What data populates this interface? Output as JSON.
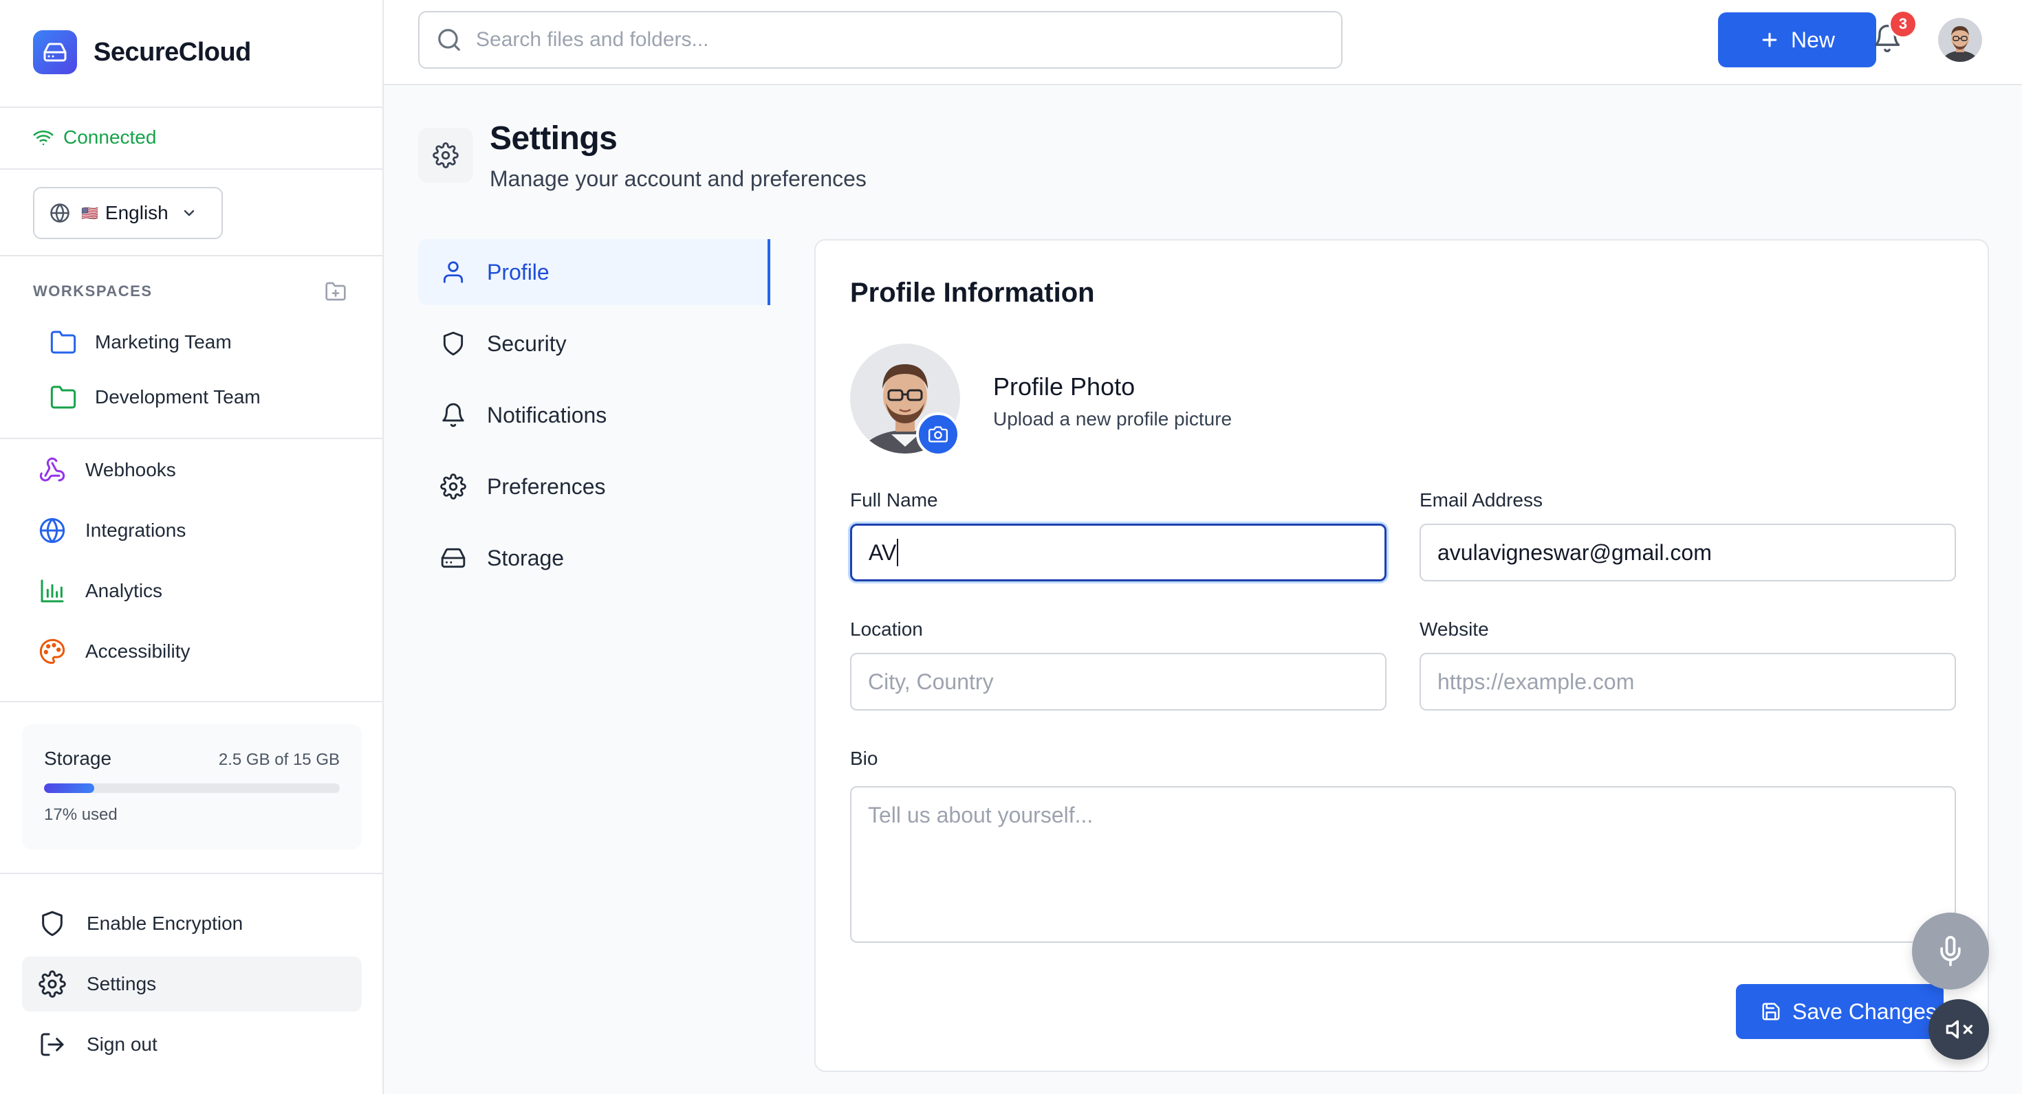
{
  "app": {
    "name": "SecureCloud",
    "accent": "#2563eb"
  },
  "sidebar": {
    "connection": {
      "status": "Connected",
      "color": "#16a34a",
      "icon": "wifi-icon"
    },
    "language": {
      "flag": "🇺🇸",
      "label": "English"
    },
    "workspaces": {
      "title": "WORKSPACES",
      "items": [
        {
          "label": "Marketing Team",
          "icon": "folder-icon",
          "color": "#2563eb"
        },
        {
          "label": "Development Team",
          "icon": "folder-icon",
          "color": "#16a34a"
        }
      ]
    },
    "nav": [
      {
        "label": "Webhooks",
        "icon": "webhook-icon",
        "color": "#9333ea"
      },
      {
        "label": "Integrations",
        "icon": "globe-icon",
        "color": "#2563eb"
      },
      {
        "label": "Analytics",
        "icon": "bar-chart-icon",
        "color": "#16a34a"
      },
      {
        "label": "Accessibility",
        "icon": "palette-icon",
        "color": "#ea580c"
      }
    ],
    "storage": {
      "title": "Storage",
      "size": "2.5 GB of 15 GB",
      "used_label": "17% used",
      "used_fraction": 0.17
    },
    "bottom": [
      {
        "label": "Enable Encryption",
        "icon": "shield-icon"
      },
      {
        "label": "Settings",
        "icon": "gear-icon",
        "active": true
      },
      {
        "label": "Sign out",
        "icon": "logout-icon"
      }
    ]
  },
  "header": {
    "search_placeholder": "Search files and folders...",
    "new_label": "New",
    "notifications_count": "3"
  },
  "page": {
    "title": "Settings",
    "subtitle": "Manage your account and preferences",
    "tabs": [
      {
        "label": "Profile",
        "icon": "user-icon",
        "active": true
      },
      {
        "label": "Security",
        "icon": "shield-icon"
      },
      {
        "label": "Notifications",
        "icon": "bell-icon"
      },
      {
        "label": "Preferences",
        "icon": "gear-icon"
      },
      {
        "label": "Storage",
        "icon": "hard-drive-icon"
      }
    ]
  },
  "profile": {
    "title": "Profile Information",
    "photo_title": "Profile Photo",
    "photo_subtitle": "Upload a new profile picture",
    "full_name_label": "Full Name",
    "full_name_value": "AV",
    "email_label": "Email Address",
    "email_value": "avulavigneswar@gmail.com",
    "location_label": "Location",
    "location_placeholder": "City, Country",
    "website_label": "Website",
    "website_placeholder": "https://example.com",
    "bio_label": "Bio",
    "bio_placeholder": "Tell us about yourself...",
    "save_label": "Save Changes"
  }
}
